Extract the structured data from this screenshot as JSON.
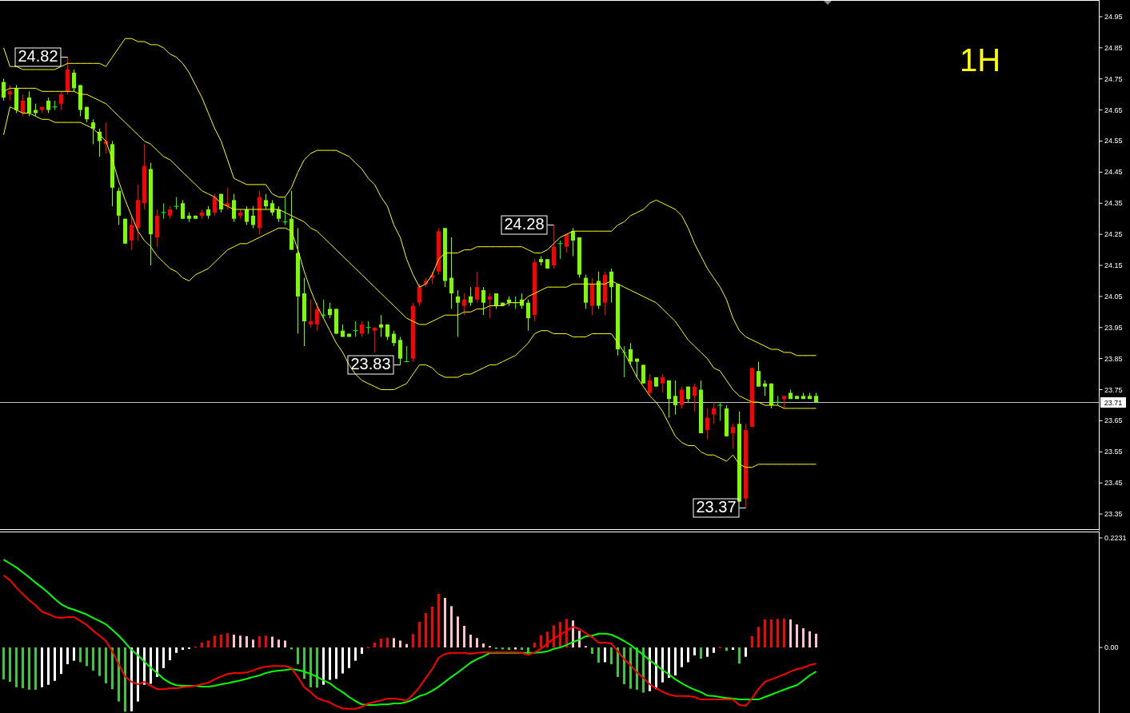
{
  "price_chart": {
    "timeframe_label": "1H",
    "chart_data": {
      "type": "candlestick",
      "categories": [
        null,
        null,
        null,
        null,
        null,
        null,
        null,
        null,
        null,
        null,
        null,
        null,
        null,
        null,
        null,
        null,
        null,
        null,
        null,
        null,
        null,
        null,
        null,
        null,
        null,
        null,
        null,
        null,
        null,
        null,
        null,
        null,
        null,
        null,
        null,
        null,
        null,
        null,
        null,
        null,
        null,
        null,
        null,
        null,
        null,
        null,
        null,
        null,
        null,
        null,
        null,
        null,
        null,
        null,
        null,
        null,
        null,
        null,
        null,
        null,
        null,
        null,
        null,
        null,
        null,
        null,
        null,
        null,
        null,
        null,
        null,
        null,
        null,
        null,
        null,
        null,
        null,
        null,
        null,
        null,
        null,
        null,
        null,
        null,
        null,
        null,
        null,
        null,
        null,
        null,
        null,
        null,
        null,
        null,
        null,
        null,
        null,
        null,
        null,
        null,
        null,
        null,
        null,
        null,
        null,
        null,
        null,
        null,
        null,
        null,
        null,
        null,
        null,
        null,
        null,
        null,
        null,
        null,
        null,
        null,
        null,
        null,
        null,
        null,
        null,
        null,
        null,
        null
      ],
      "ylim": [
        23.3,
        25.0
      ],
      "yticks": [
        24.95,
        24.85,
        24.75,
        24.65,
        24.55,
        24.45,
        24.35,
        24.25,
        24.15,
        24.05,
        23.95,
        23.85,
        23.75,
        23.65,
        23.55,
        23.45,
        23.35
      ],
      "ohlc": [
        [
          24.74,
          24.75,
          24.68,
          24.69
        ],
        [
          24.7,
          24.73,
          24.68,
          24.71
        ],
        [
          24.72,
          24.73,
          24.64,
          24.65
        ],
        [
          24.64,
          24.7,
          24.63,
          24.68
        ],
        [
          24.69,
          24.71,
          24.63,
          24.64
        ],
        [
          24.65,
          24.67,
          24.63,
          24.64
        ],
        [
          24.65,
          24.66,
          24.64,
          24.66
        ],
        [
          24.68,
          24.69,
          24.64,
          24.65
        ],
        [
          24.66,
          24.68,
          24.65,
          24.66
        ],
        [
          24.67,
          24.71,
          24.65,
          24.7
        ],
        [
          24.71,
          24.82,
          24.7,
          24.78
        ],
        [
          24.77,
          24.78,
          24.71,
          24.72
        ],
        [
          24.73,
          24.73,
          24.63,
          24.65
        ],
        [
          24.66,
          24.66,
          24.61,
          24.62
        ],
        [
          24.61,
          24.62,
          24.54,
          24.59
        ],
        [
          24.58,
          24.59,
          24.5,
          24.55
        ],
        [
          24.54,
          24.61,
          24.51,
          24.55
        ],
        [
          24.54,
          24.55,
          24.34,
          24.4
        ],
        [
          24.39,
          24.4,
          24.28,
          24.31
        ],
        [
          24.3,
          24.3,
          24.22,
          24.22
        ],
        [
          24.23,
          24.31,
          24.2,
          24.28
        ],
        [
          24.27,
          24.41,
          24.23,
          24.36
        ],
        [
          24.35,
          24.54,
          24.33,
          24.47
        ],
        [
          24.46,
          24.48,
          24.15,
          24.25
        ],
        [
          24.24,
          24.33,
          24.21,
          24.31
        ],
        [
          24.32,
          24.35,
          24.3,
          24.32
        ],
        [
          24.31,
          24.34,
          24.3,
          24.33
        ],
        [
          24.34,
          24.37,
          24.33,
          24.34
        ],
        [
          24.35,
          24.36,
          24.3,
          24.3
        ],
        [
          24.31,
          24.32,
          24.29,
          24.3
        ],
        [
          24.31,
          24.31,
          24.3,
          24.3
        ],
        [
          24.31,
          24.33,
          24.3,
          24.32
        ],
        [
          24.33,
          24.34,
          24.3,
          24.31
        ],
        [
          24.32,
          24.38,
          24.31,
          24.37
        ],
        [
          24.38,
          24.38,
          24.32,
          24.33
        ],
        [
          24.34,
          24.4,
          24.33,
          24.35
        ],
        [
          24.36,
          24.38,
          24.29,
          24.3
        ],
        [
          24.31,
          24.33,
          24.3,
          24.32
        ],
        [
          24.33,
          24.34,
          24.28,
          24.29
        ],
        [
          24.31,
          24.34,
          24.27,
          24.28
        ],
        [
          24.27,
          24.39,
          24.25,
          24.37
        ],
        [
          24.36,
          24.38,
          24.33,
          24.34
        ],
        [
          24.35,
          24.36,
          24.31,
          24.32
        ],
        [
          24.33,
          24.34,
          24.29,
          24.3
        ],
        [
          24.29,
          24.37,
          24.28,
          24.29
        ],
        [
          24.3,
          24.39,
          24.2,
          24.2
        ],
        [
          24.19,
          24.27,
          23.93,
          24.05
        ],
        [
          24.06,
          24.11,
          23.89,
          23.97
        ],
        [
          23.96,
          24.04,
          23.95,
          23.97
        ],
        [
          23.96,
          24.03,
          23.94,
          24.01
        ],
        [
          23.99,
          24.04,
          23.98,
          23.99
        ],
        [
          24.01,
          24.03,
          23.98,
          23.99
        ],
        [
          24.01,
          24.01,
          23.93,
          23.93
        ],
        [
          23.94,
          23.96,
          23.92,
          23.92
        ],
        [
          23.93,
          23.93,
          23.92,
          23.92
        ],
        [
          23.94,
          23.97,
          23.92,
          23.94
        ],
        [
          23.93,
          23.97,
          23.92,
          23.96
        ],
        [
          23.95,
          23.97,
          23.93,
          23.95
        ],
        [
          23.94,
          23.95,
          23.87,
          23.95
        ],
        [
          23.96,
          23.99,
          23.92,
          23.95
        ],
        [
          23.96,
          23.96,
          23.91,
          23.92
        ],
        [
          23.93,
          23.94,
          23.89,
          23.9
        ],
        [
          23.91,
          23.92,
          23.83,
          23.85
        ],
        [
          23.84,
          23.89,
          23.84,
          23.84
        ],
        [
          23.85,
          24.03,
          23.84,
          24.02
        ],
        [
          24.03,
          24.09,
          24.02,
          24.08
        ],
        [
          24.09,
          24.11,
          24.08,
          24.1
        ],
        [
          24.11,
          24.13,
          24.09,
          24.12
        ],
        [
          24.13,
          24.27,
          24.12,
          24.26
        ],
        [
          24.27,
          24.27,
          24.08,
          24.1
        ],
        [
          24.11,
          24.24,
          24.01,
          24.06
        ],
        [
          24.05,
          24.07,
          23.92,
          24.03
        ],
        [
          24.02,
          24.06,
          23.99,
          24.04
        ],
        [
          24.05,
          24.08,
          24.02,
          24.03
        ],
        [
          24.04,
          24.13,
          24.03,
          24.08
        ],
        [
          24.07,
          24.08,
          23.99,
          24.03
        ],
        [
          24.04,
          24.06,
          23.98,
          24.05
        ],
        [
          24.06,
          24.06,
          24.01,
          24.02
        ],
        [
          24.03,
          24.03,
          24.02,
          24.02
        ],
        [
          24.04,
          24.05,
          24.02,
          24.03
        ],
        [
          24.03,
          24.05,
          24.01,
          24.03
        ],
        [
          24.04,
          24.06,
          24.01,
          24.02
        ],
        [
          24.03,
          24.04,
          23.94,
          23.98
        ],
        [
          23.99,
          24.17,
          23.97,
          24.16
        ],
        [
          24.17,
          24.18,
          24.15,
          24.16
        ],
        [
          24.17,
          24.17,
          24.14,
          24.14
        ],
        [
          24.15,
          24.28,
          24.14,
          24.21
        ],
        [
          24.22,
          24.23,
          24.17,
          24.22
        ],
        [
          24.21,
          24.25,
          24.19,
          24.25
        ],
        [
          24.26,
          24.27,
          24.18,
          24.23
        ],
        [
          24.24,
          24.24,
          24.11,
          24.12
        ],
        [
          24.11,
          24.12,
          24.01,
          24.03
        ],
        [
          24.02,
          24.11,
          23.99,
          24.09
        ],
        [
          24.1,
          24.13,
          24.01,
          24.02
        ],
        [
          24.03,
          24.13,
          23.99,
          24.12
        ],
        [
          24.13,
          24.14,
          24.03,
          24.08
        ],
        [
          24.09,
          24.09,
          23.86,
          23.88
        ],
        [
          23.87,
          23.89,
          23.79,
          23.87
        ],
        [
          23.88,
          23.9,
          23.83,
          23.84
        ],
        [
          23.85,
          23.85,
          23.79,
          23.84
        ],
        [
          23.83,
          23.83,
          23.77,
          23.77
        ],
        [
          23.74,
          23.8,
          23.73,
          23.78
        ],
        [
          23.79,
          23.79,
          23.76,
          23.76
        ],
        [
          23.77,
          23.8,
          23.74,
          23.79
        ],
        [
          23.78,
          23.78,
          23.66,
          23.72
        ],
        [
          23.73,
          23.78,
          23.67,
          23.7
        ],
        [
          23.7,
          23.76,
          23.69,
          23.75
        ],
        [
          23.76,
          23.76,
          23.71,
          23.72
        ],
        [
          23.73,
          23.77,
          23.68,
          23.76
        ],
        [
          23.75,
          23.78,
          23.61,
          23.61
        ],
        [
          23.62,
          23.69,
          23.59,
          23.66
        ],
        [
          23.67,
          23.71,
          23.64,
          23.69
        ],
        [
          23.7,
          23.71,
          23.65,
          23.7
        ],
        [
          23.69,
          23.7,
          23.6,
          23.6
        ],
        [
          23.61,
          23.64,
          23.56,
          23.63
        ],
        [
          23.64,
          23.68,
          23.39,
          23.39
        ],
        [
          23.4,
          23.64,
          23.37,
          23.62
        ],
        [
          23.63,
          23.82,
          23.63,
          23.82
        ],
        [
          23.81,
          23.84,
          23.76,
          23.76
        ],
        [
          23.77,
          23.78,
          23.73,
          23.76
        ],
        [
          23.77,
          23.77,
          23.69,
          23.7
        ],
        [
          23.71,
          23.73,
          23.7,
          23.71
        ],
        [
          23.72,
          23.73,
          23.69,
          23.73
        ],
        [
          23.74,
          23.75,
          23.72,
          23.72
        ],
        [
          23.73,
          23.73,
          23.72,
          23.72
        ],
        [
          23.73,
          23.74,
          23.72,
          23.72
        ],
        [
          23.73,
          23.74,
          23.72,
          23.72
        ],
        [
          23.73,
          23.74,
          23.71,
          23.71
        ]
      ],
      "series": [
        {
          "type": "line",
          "color": "#ffff00",
          "values": [
            24.85,
            24.79,
            24.79,
            24.78,
            24.78,
            24.78,
            24.78,
            24.78,
            24.78,
            24.79,
            24.8,
            24.8,
            24.8,
            24.8,
            24.8,
            24.8,
            24.79,
            24.82,
            24.85,
            24.88,
            24.88,
            24.87,
            24.87,
            24.86,
            24.86,
            24.85,
            24.83,
            24.82,
            24.8,
            24.77,
            24.73,
            24.69,
            24.64,
            24.59,
            24.55,
            24.49,
            24.43,
            24.42,
            24.41,
            24.41,
            24.41,
            24.41,
            24.38,
            24.37,
            24.37,
            24.4,
            24.45,
            24.49,
            24.51,
            24.52,
            24.52,
            24.52,
            24.52,
            24.51,
            24.5,
            24.48,
            24.46,
            24.43,
            24.41,
            24.37,
            24.34,
            24.28,
            24.24,
            24.17,
            24.12,
            24.08,
            24.09,
            24.12,
            24.17,
            24.19,
            24.19,
            24.19,
            24.2,
            24.2,
            24.21,
            24.21,
            24.21,
            24.21,
            24.21,
            24.21,
            24.21,
            24.21,
            24.2,
            24.19,
            24.19,
            24.2,
            24.22,
            24.24,
            24.25,
            24.26,
            24.26,
            24.26,
            24.26,
            24.26,
            24.26,
            24.26,
            24.28,
            24.29,
            24.31,
            24.32,
            24.33,
            24.35,
            24.36,
            24.35,
            24.34,
            24.33,
            24.31,
            24.27,
            24.22,
            24.18,
            24.14,
            24.11,
            24.08,
            24.04,
            23.98,
            23.94,
            23.92,
            23.91,
            23.9,
            23.89,
            23.88,
            23.88,
            23.87,
            23.87,
            23.86,
            23.86,
            23.86,
            23.86
          ]
        },
        {
          "type": "line",
          "color": "#ffff00",
          "values": [
            24.71,
            24.72,
            24.72,
            24.72,
            24.72,
            24.72,
            24.71,
            24.71,
            24.71,
            24.71,
            24.71,
            24.71,
            24.7,
            24.7,
            24.69,
            24.68,
            24.67,
            24.65,
            24.63,
            24.61,
            24.59,
            24.57,
            24.55,
            24.54,
            24.52,
            24.5,
            24.49,
            24.47,
            24.45,
            24.43,
            24.41,
            24.39,
            24.38,
            24.37,
            24.35,
            24.34,
            24.33,
            24.33,
            24.33,
            24.33,
            24.33,
            24.33,
            24.33,
            24.33,
            24.32,
            24.31,
            24.3,
            24.29,
            24.27,
            24.26,
            24.24,
            24.22,
            24.2,
            24.18,
            24.16,
            24.14,
            24.12,
            24.1,
            24.08,
            24.06,
            24.04,
            24.02,
            24.0,
            23.98,
            23.97,
            23.96,
            23.96,
            23.97,
            23.98,
            23.99,
            23.99,
            23.99,
            24.0,
            24.0,
            24.01,
            24.01,
            24.02,
            24.02,
            24.02,
            24.03,
            24.03,
            24.03,
            24.05,
            24.06,
            24.07,
            24.08,
            24.08,
            24.08,
            24.08,
            24.09,
            24.09,
            24.09,
            24.09,
            24.09,
            24.09,
            24.1,
            24.09,
            24.08,
            24.07,
            24.06,
            24.05,
            24.04,
            24.03,
            24.01,
            23.99,
            23.97,
            23.94,
            23.91,
            23.89,
            23.87,
            23.85,
            23.82,
            23.81,
            23.78,
            23.75,
            23.73,
            23.72,
            23.71,
            23.71,
            23.7,
            23.7,
            23.7,
            23.69,
            23.69,
            23.69,
            23.69,
            23.69,
            23.69
          ]
        },
        {
          "type": "line",
          "color": "#ffff00",
          "values": [
            24.57,
            24.66,
            24.65,
            24.64,
            24.64,
            24.63,
            24.62,
            24.62,
            24.61,
            24.61,
            24.61,
            24.61,
            24.61,
            24.6,
            24.59,
            24.57,
            24.55,
            24.49,
            24.42,
            24.36,
            24.31,
            24.26,
            24.23,
            24.21,
            24.18,
            24.16,
            24.14,
            24.13,
            24.11,
            24.1,
            24.12,
            24.13,
            24.14,
            24.16,
            24.18,
            24.2,
            24.21,
            24.22,
            24.22,
            24.23,
            24.24,
            24.25,
            24.26,
            24.27,
            24.27,
            24.26,
            24.2,
            24.13,
            24.07,
            24.02,
            23.98,
            23.94,
            23.9,
            23.87,
            23.83,
            23.8,
            23.78,
            23.77,
            23.76,
            23.75,
            23.75,
            23.75,
            23.76,
            23.77,
            23.8,
            23.83,
            23.83,
            23.82,
            23.8,
            23.79,
            23.79,
            23.79,
            23.8,
            23.8,
            23.81,
            23.82,
            23.83,
            23.83,
            23.84,
            23.85,
            23.86,
            23.88,
            23.9,
            23.93,
            23.94,
            23.94,
            23.93,
            23.93,
            23.93,
            23.92,
            23.92,
            23.92,
            23.93,
            23.93,
            23.93,
            23.93,
            23.9,
            23.87,
            23.83,
            23.79,
            23.76,
            23.73,
            23.71,
            23.68,
            23.64,
            23.6,
            23.58,
            23.57,
            23.57,
            23.55,
            23.54,
            23.54,
            23.53,
            23.52,
            23.54,
            23.51,
            23.5,
            23.5,
            23.51,
            23.51,
            23.51,
            23.51,
            23.51,
            23.51,
            23.51,
            23.51,
            23.51,
            23.51
          ]
        }
      ],
      "ref_lines": [
        {
          "axis": "y",
          "value": 23.71,
          "label": "23.71",
          "color": "#c0c0c0"
        }
      ],
      "annotations": [
        "24.82",
        "24.28",
        "23.83",
        "23.37"
      ]
    }
  },
  "macd_chart": {
    "chart_data": {
      "type": "bar",
      "categories": [
        null,
        null,
        null,
        null,
        null,
        null,
        null,
        null,
        null,
        null,
        null,
        null,
        null,
        null,
        null,
        null,
        null,
        null,
        null,
        null,
        null,
        null,
        null,
        null,
        null,
        null,
        null,
        null,
        null,
        null,
        null,
        null,
        null,
        null,
        null,
        null,
        null,
        null,
        null,
        null,
        null,
        null,
        null,
        null,
        null,
        null,
        null,
        null,
        null,
        null,
        null,
        null,
        null,
        null,
        null,
        null,
        null,
        null,
        null,
        null,
        null,
        null,
        null,
        null,
        null,
        null,
        null,
        null,
        null,
        null,
        null,
        null,
        null,
        null,
        null,
        null,
        null,
        null,
        null,
        null,
        null,
        null,
        null,
        null,
        null,
        null,
        null,
        null,
        null,
        null,
        null,
        null,
        null,
        null,
        null,
        null,
        null,
        null,
        null,
        null,
        null,
        null,
        null,
        null,
        null,
        null,
        null,
        null,
        null,
        null,
        null,
        null,
        null,
        null,
        null,
        null,
        null,
        null,
        null,
        null,
        null,
        null,
        null,
        null,
        null,
        null,
        null,
        null
      ],
      "ylim": [
        -0.1335,
        0.2377
      ],
      "yticks": [
        0.2231,
        {
          "value": 0,
          "label": "0.00"
        }
      ],
      "series": [
        {
          "values": [
            -0.065,
            -0.07,
            -0.081,
            -0.083,
            -0.086,
            -0.086,
            -0.081,
            -0.076,
            -0.068,
            -0.054,
            -0.034,
            -0.027,
            -0.03,
            -0.038,
            -0.047,
            -0.058,
            -0.073,
            -0.085,
            -0.11,
            -0.131,
            -0.13,
            -0.11,
            -0.076,
            -0.074,
            -0.06,
            -0.042,
            -0.026,
            -0.011,
            -0.005,
            -0.003,
            0.002,
            0.01,
            0.014,
            0.024,
            0.026,
            0.029,
            0.026,
            0.024,
            0.023,
            0.016,
            0.023,
            0.024,
            0.022,
            0.016,
            0.014,
            -0.004,
            -0.034,
            -0.064,
            -0.081,
            -0.082,
            -0.076,
            -0.066,
            -0.064,
            -0.053,
            -0.042,
            -0.027,
            -0.013,
            0.001,
            0.01,
            0.018,
            0.02,
            0.019,
            0.014,
            0.007,
            0.027,
            0.052,
            0.07,
            0.083,
            0.109,
            0.101,
            0.084,
            0.063,
            0.044,
            0.026,
            0.019,
            0.008,
            0.003,
            -0.003,
            -0.004,
            -0.005,
            -0.004,
            -0.005,
            -0.011,
            0.01,
            0.025,
            0.032,
            0.045,
            0.052,
            0.058,
            0.055,
            0.034,
            0.003,
            -0.013,
            -0.031,
            -0.03,
            -0.034,
            -0.06,
            -0.075,
            -0.084,
            -0.086,
            -0.092,
            -0.089,
            -0.085,
            -0.071,
            -0.062,
            -0.057,
            -0.04,
            -0.03,
            -0.016,
            -0.023,
            -0.019,
            -0.011,
            0.001,
            -0.007,
            -0.005,
            -0.033,
            -0.019,
            0.023,
            0.042,
            0.057,
            0.057,
            0.058,
            0.059,
            0.057,
            0.047,
            0.039,
            0.033,
            0.028
          ],
          "colors": [
            "#32cd32",
            "#32cd32",
            "#32cd32",
            "#32cd32",
            "#32cd32",
            "#32cd32",
            "#ffffff",
            "#ffffff",
            "#ffffff",
            "#ffffff",
            "#ffffff",
            "#ffffff",
            "#32cd32",
            "#32cd32",
            "#32cd32",
            "#32cd32",
            "#32cd32",
            "#32cd32",
            "#32cd32",
            "#32cd32",
            "#ffffff",
            "#ffffff",
            "#ffffff",
            "#ffffff",
            "#ffffff",
            "#ffffff",
            "#ffffff",
            "#ffffff",
            "#ffffff",
            "#ffffff",
            "#ff0000",
            "#ff0000",
            "#ff0000",
            "#ff0000",
            "#ff0000",
            "#ff0000",
            "#ffc0cb",
            "#ffc0cb",
            "#ffc0cb",
            "#ffc0cb",
            "#ff0000",
            "#ff0000",
            "#ffc0cb",
            "#ffc0cb",
            "#ffc0cb",
            "#32cd32",
            "#32cd32",
            "#32cd32",
            "#32cd32",
            "#32cd32",
            "#ffffff",
            "#ffffff",
            "#ffffff",
            "#ffffff",
            "#ffffff",
            "#ffffff",
            "#ffffff",
            "#ff0000",
            "#ff0000",
            "#ff0000",
            "#ff0000",
            "#ffc0cb",
            "#ffc0cb",
            "#ffc0cb",
            "#ff0000",
            "#ff0000",
            "#ff0000",
            "#ff0000",
            "#ff0000",
            "#ffc0cb",
            "#ffc0cb",
            "#ffc0cb",
            "#ffc0cb",
            "#ffc0cb",
            "#ffc0cb",
            "#ffc0cb",
            "#ffc0cb",
            "#32cd32",
            "#32cd32",
            "#32cd32",
            "#ffffff",
            "#32cd32",
            "#32cd32",
            "#ff0000",
            "#ff0000",
            "#ff0000",
            "#ff0000",
            "#ff0000",
            "#ff0000",
            "#ffc0cb",
            "#ffc0cb",
            "#ffc0cb",
            "#32cd32",
            "#32cd32",
            "#ffffff",
            "#32cd32",
            "#32cd32",
            "#32cd32",
            "#32cd32",
            "#32cd32",
            "#32cd32",
            "#ffffff",
            "#ffffff",
            "#ffffff",
            "#ffffff",
            "#ffffff",
            "#ffffff",
            "#ffffff",
            "#ffffff",
            "#32cd32",
            "#ffffff",
            "#ffffff",
            "#ff0000",
            "#32cd32",
            "#ffffff",
            "#32cd32",
            "#ffffff",
            "#ff0000",
            "#ff0000",
            "#ff0000",
            "#ff0000",
            "#ff0000",
            "#ff0000",
            "#ffc0cb",
            "#ffc0cb",
            "#ffc0cb",
            "#ffc0cb",
            "#ffc0cb"
          ]
        },
        {
          "type": "line",
          "color": "#00ff00",
          "values": [
            0.179,
            0.171,
            0.163,
            0.153,
            0.143,
            0.132,
            0.122,
            0.111,
            0.099,
            0.088,
            0.081,
            0.077,
            0.072,
            0.067,
            0.06,
            0.054,
            0.047,
            0.036,
            0.024,
            0.01,
            -0.005,
            -0.016,
            -0.029,
            -0.041,
            -0.052,
            -0.064,
            -0.072,
            -0.077,
            -0.078,
            -0.078,
            -0.078,
            -0.08,
            -0.08,
            -0.078,
            -0.075,
            -0.073,
            -0.07,
            -0.067,
            -0.064,
            -0.06,
            -0.057,
            -0.052,
            -0.049,
            -0.047,
            -0.046,
            -0.044,
            -0.046,
            -0.049,
            -0.054,
            -0.06,
            -0.067,
            -0.073,
            -0.083,
            -0.091,
            -0.101,
            -0.109,
            -0.116,
            -0.117,
            -0.117,
            -0.116,
            -0.116,
            -0.114,
            -0.114,
            -0.111,
            -0.106,
            -0.099,
            -0.095,
            -0.088,
            -0.08,
            -0.07,
            -0.06,
            -0.051,
            -0.041,
            -0.031,
            -0.024,
            -0.018,
            -0.011,
            -0.011,
            -0.011,
            -0.011,
            -0.011,
            -0.011,
            -0.011,
            -0.011,
            -0.01,
            -0.008,
            -0.003,
            0,
            0.005,
            0.011,
            0.016,
            0.023,
            0.024,
            0.028,
            0.028,
            0.026,
            0.02,
            0.013,
            0.005,
            -0.005,
            -0.015,
            -0.026,
            -0.036,
            -0.046,
            -0.055,
            -0.065,
            -0.073,
            -0.08,
            -0.086,
            -0.091,
            -0.098,
            -0.099,
            -0.101,
            -0.103,
            -0.104,
            -0.106,
            -0.106,
            -0.106,
            -0.106,
            -0.101,
            -0.096,
            -0.091,
            -0.086,
            -0.081,
            -0.077,
            -0.067,
            -0.057,
            -0.049
          ]
        },
        {
          "type": "line",
          "color": "#ff0000",
          "values": [
            0.147,
            0.137,
            0.122,
            0.109,
            0.096,
            0.086,
            0.073,
            0.068,
            0.062,
            0.06,
            0.062,
            0.062,
            0.054,
            0.046,
            0.034,
            0.024,
            0.013,
            -0.008,
            -0.034,
            -0.059,
            -0.07,
            -0.075,
            -0.07,
            -0.078,
            -0.085,
            -0.085,
            -0.083,
            -0.083,
            -0.081,
            -0.08,
            -0.078,
            -0.075,
            -0.072,
            -0.065,
            -0.059,
            -0.054,
            -0.052,
            -0.052,
            -0.051,
            -0.047,
            -0.042,
            -0.039,
            -0.038,
            -0.038,
            -0.038,
            -0.042,
            -0.06,
            -0.081,
            -0.091,
            -0.103,
            -0.108,
            -0.112,
            -0.119,
            -0.124,
            -0.125,
            -0.125,
            -0.121,
            -0.114,
            -0.111,
            -0.108,
            -0.104,
            -0.104,
            -0.106,
            -0.108,
            -0.096,
            -0.081,
            -0.062,
            -0.044,
            -0.021,
            -0.013,
            -0.011,
            -0.011,
            -0.011,
            -0.013,
            -0.011,
            -0.01,
            -0.01,
            -0.01,
            -0.01,
            -0.01,
            -0.01,
            -0.011,
            -0.015,
            -0.01,
            -0.003,
            0.008,
            0.018,
            0.026,
            0.034,
            0.042,
            0.038,
            0.029,
            0.021,
            0.01,
            0.01,
            0.008,
            -0.008,
            -0.024,
            -0.036,
            -0.051,
            -0.062,
            -0.075,
            -0.083,
            -0.09,
            -0.096,
            -0.099,
            -0.099,
            -0.099,
            -0.101,
            -0.106,
            -0.106,
            -0.106,
            -0.106,
            -0.106,
            -0.106,
            -0.117,
            -0.119,
            -0.103,
            -0.085,
            -0.07,
            -0.065,
            -0.06,
            -0.055,
            -0.049,
            -0.044,
            -0.041,
            -0.036,
            -0.033
          ]
        }
      ]
    }
  }
}
